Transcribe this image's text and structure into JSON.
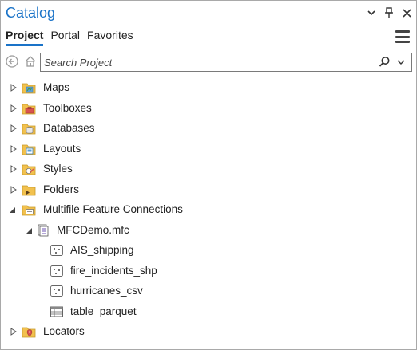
{
  "pane": {
    "title": "Catalog",
    "controls": {
      "dropdown": "▾",
      "pin": "📌",
      "close": "✕"
    }
  },
  "tabs": [
    {
      "label": "Project",
      "active": true
    },
    {
      "label": "Portal",
      "active": false
    },
    {
      "label": "Favorites",
      "active": false
    }
  ],
  "search": {
    "placeholder": "Search Project",
    "value": ""
  },
  "tree": {
    "maps": "Maps",
    "toolboxes": "Toolboxes",
    "databases": "Databases",
    "layouts": "Layouts",
    "styles": "Styles",
    "folders": "Folders",
    "mfc_connections": "Multifile Feature Connections",
    "mfc_file": "MFCDemo.mfc",
    "ais": "AIS_shipping",
    "fire": "fire_incidents_shp",
    "hurricanes": "hurricanes_csv",
    "parquet": "table_parquet",
    "locators": "Locators"
  },
  "colors": {
    "accent": "#1a73c8",
    "folder": "#f2c14e"
  }
}
